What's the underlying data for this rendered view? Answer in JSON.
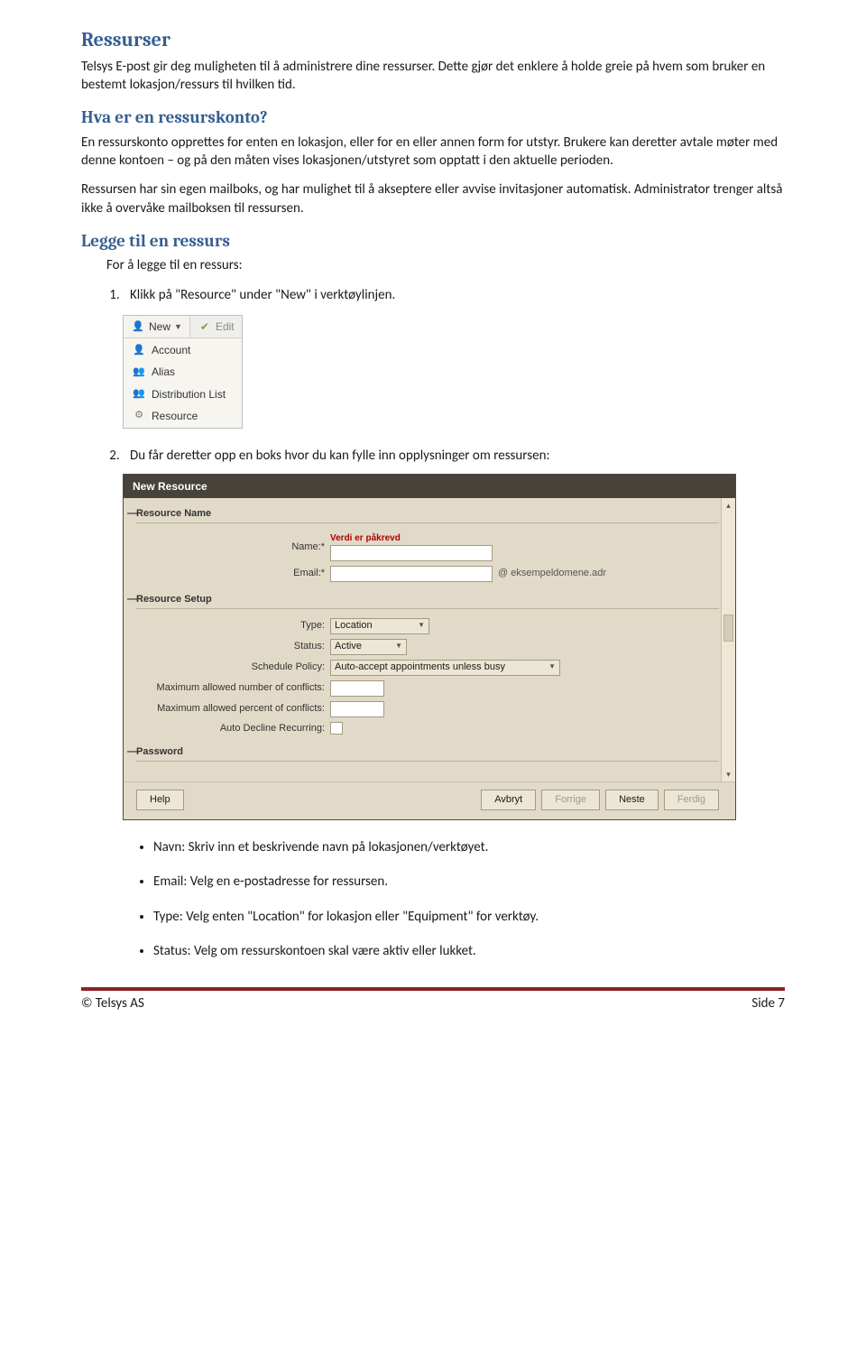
{
  "h1": "Ressurser",
  "p1": "Telsys E-post gir deg muligheten til å administrere dine ressurser. Dette gjør det enklere å holde greie på hvem som bruker en bestemt lokasjon/ressurs til hvilken tid.",
  "h2a": "Hva er en ressurskonto?",
  "p2": "En ressurskonto opprettes for enten en lokasjon, eller for en eller annen form for utstyr. Brukere kan deretter avtale møter med denne kontoen – og på den måten vises lokasjonen/utstyret som opptatt i den aktuelle perioden.",
  "p3": "Ressursen har sin egen mailboks, og har mulighet til å akseptere eller avvise invitasjoner automatisk. Administrator trenger altså ikke å overvåke mailboksen til ressursen.",
  "h2b": "Legge til en ressurs",
  "p4": "For å legge til en ressurs:",
  "ol1": "Klikk på \"Resource\" under \"New\" i verktøylinjen.",
  "ol2": "Du får deretter opp en boks hvor du kan fylle inn opplysninger om ressursen:",
  "dropdown": {
    "newLabel": "New",
    "editLabel": "Edit",
    "items": [
      "Account",
      "Alias",
      "Distribution List",
      "Resource"
    ]
  },
  "dialog": {
    "title": "New Resource",
    "groups": {
      "name": "Resource Name",
      "setup": "Resource Setup",
      "pass": "Password"
    },
    "reqMsg": "Verdi er påkrevd",
    "labels": {
      "name": "Name:*",
      "email": "Email:*",
      "type": "Type:",
      "status": "Status:",
      "policy": "Schedule Policy:",
      "maxNum": "Maximum allowed number of conflicts:",
      "maxPct": "Maximum allowed percent of conflicts:",
      "autoDec": "Auto Decline Recurring:"
    },
    "values": {
      "type": "Location",
      "status": "Active",
      "policy": "Auto-accept appointments unless busy"
    },
    "domain": "@  eksempeldomene.adr",
    "buttons": {
      "help": "Help",
      "cancel": "Avbryt",
      "prev": "Forrige",
      "next": "Neste",
      "finish": "Ferdig"
    }
  },
  "bullets": [
    "Navn: Skriv inn et beskrivende navn på lokasjonen/verktøyet.",
    "Email: Velg en e-postadresse for ressursen.",
    "Type: Velg enten \"Location\" for lokasjon eller \"Equipment\" for verktøy.",
    "Status: Velg om ressurskontoen skal være aktiv eller lukket."
  ],
  "footer": {
    "left": "© Telsys AS",
    "right": "Side 7"
  }
}
